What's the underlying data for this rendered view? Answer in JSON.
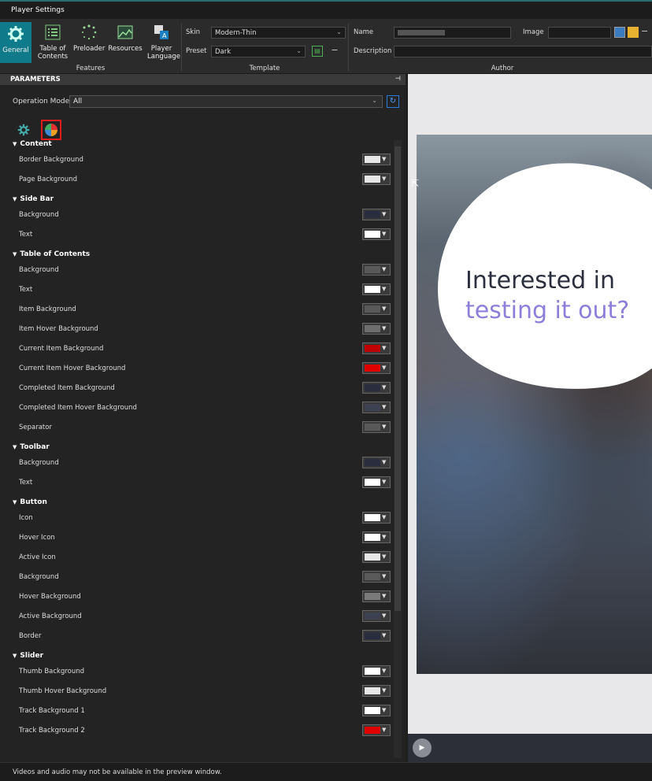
{
  "window": {
    "title": "Player Settings"
  },
  "ribbon": {
    "buttons": [
      {
        "label": "General"
      },
      {
        "label": "Table of Contents"
      },
      {
        "label": "Preloader"
      },
      {
        "label": "Resources"
      },
      {
        "label": "Player Language"
      }
    ],
    "groups": {
      "features": "Features",
      "template": "Template",
      "author": "Author"
    },
    "skin_label": "Skin",
    "skin_value": "Modern-Thin",
    "preset_label": "Preset",
    "preset_value": "Dark",
    "name_label": "Name",
    "image_label": "Image",
    "description_label": "Description"
  },
  "params": {
    "header": "PARAMETERS",
    "operation_mode_label": "Operation Mode",
    "operation_mode_value": "All"
  },
  "sections": [
    {
      "title": "Content",
      "rows": [
        {
          "label": "Border Background",
          "color": "#e6e6e6"
        },
        {
          "label": "Page Background",
          "color": "#e6e6e6"
        }
      ]
    },
    {
      "title": "Side Bar",
      "rows": [
        {
          "label": "Background",
          "color": "#2a2d3e"
        },
        {
          "label": "Text",
          "color": "#ffffff"
        }
      ]
    },
    {
      "title": "Table of Contents",
      "rows": [
        {
          "label": "Background",
          "color": "#5a5a5a"
        },
        {
          "label": "Text",
          "color": "#ffffff"
        },
        {
          "label": "Item Background",
          "color": "#5a5a5a"
        },
        {
          "label": "Item Hover Background",
          "color": "#6e6e6e"
        },
        {
          "label": "Current Item Background",
          "color": "#c00000"
        },
        {
          "label": "Current Item Hover Background",
          "color": "#e00000"
        },
        {
          "label": "Completed Item Background",
          "color": "#2a2d3e"
        },
        {
          "label": "Completed Item Hover Background",
          "color": "#3e4150"
        },
        {
          "label": "Separator",
          "color": "#5a5a5a"
        }
      ]
    },
    {
      "title": "Toolbar",
      "rows": [
        {
          "label": "Background",
          "color": "#2a2d3e"
        },
        {
          "label": "Text",
          "color": "#ffffff"
        }
      ]
    },
    {
      "title": "Button",
      "rows": [
        {
          "label": "Icon",
          "color": "#ffffff"
        },
        {
          "label": "Hover Icon",
          "color": "#ffffff"
        },
        {
          "label": "Active Icon",
          "color": "#e6e6e6"
        },
        {
          "label": "Background",
          "color": "#5a5a5a"
        },
        {
          "label": "Hover Background",
          "color": "#7a7a7a"
        },
        {
          "label": "Active Background",
          "color": "#3e4150"
        },
        {
          "label": "Border",
          "color": "#2a2d3e"
        }
      ]
    },
    {
      "title": "Slider",
      "rows": [
        {
          "label": "Thumb Background",
          "color": "#ffffff"
        },
        {
          "label": "Thumb Hover Background",
          "color": "#e6e6e6"
        },
        {
          "label": "Track Background 1",
          "color": "#ffffff"
        },
        {
          "label": "Track Background 2",
          "color": "#e00000"
        }
      ]
    }
  ],
  "preview": {
    "headline_line1": "Interested in",
    "headline_line2": "testing it out?",
    "headline_accent": "#8c7ed9"
  },
  "status": {
    "text": "Videos and audio may not be available in the preview window."
  }
}
